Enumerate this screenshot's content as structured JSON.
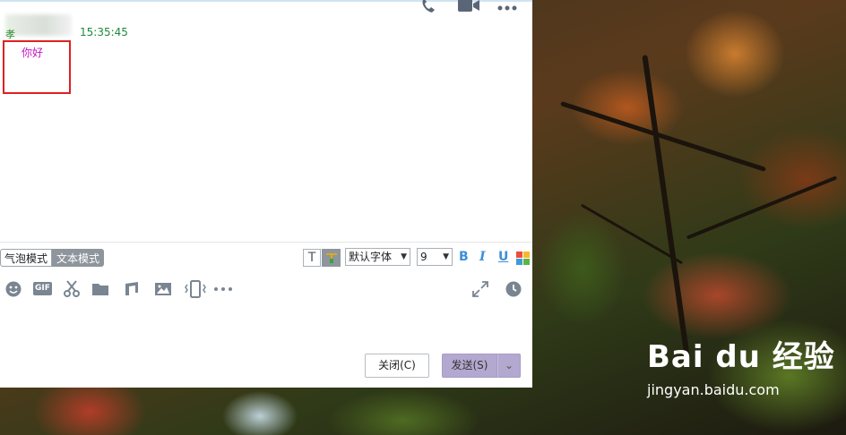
{
  "chat": {
    "timestamp": "15:35:45",
    "sender_initial": "孝",
    "message": "你好"
  },
  "toolbar": {
    "bubble_mode": "气泡模式",
    "text_mode": "文本模式",
    "font_name": "默认字体",
    "font_size": "9",
    "bold": "B",
    "italic": "I",
    "underline": "U",
    "gif": "GIF",
    "text_toggle": "T",
    "icons": [
      "emoji-icon",
      "gif-icon",
      "scissors-icon",
      "folder-icon",
      "music-icon",
      "image-icon",
      "shake-icon",
      "more-icon",
      "expand-icon",
      "history-clock-icon"
    ]
  },
  "buttons": {
    "close": "关闭(C)",
    "send": "发送(S)"
  },
  "watermark": {
    "brand": "Bai du 经验",
    "url": "jingyan.baidu.com"
  },
  "colors": {
    "message_text": "#c216c2",
    "timestamp_text": "#1e8a3c",
    "highlight_box": "#e02020",
    "send_button": "#b3a8cf",
    "format_icons": "#3d8fd8"
  }
}
